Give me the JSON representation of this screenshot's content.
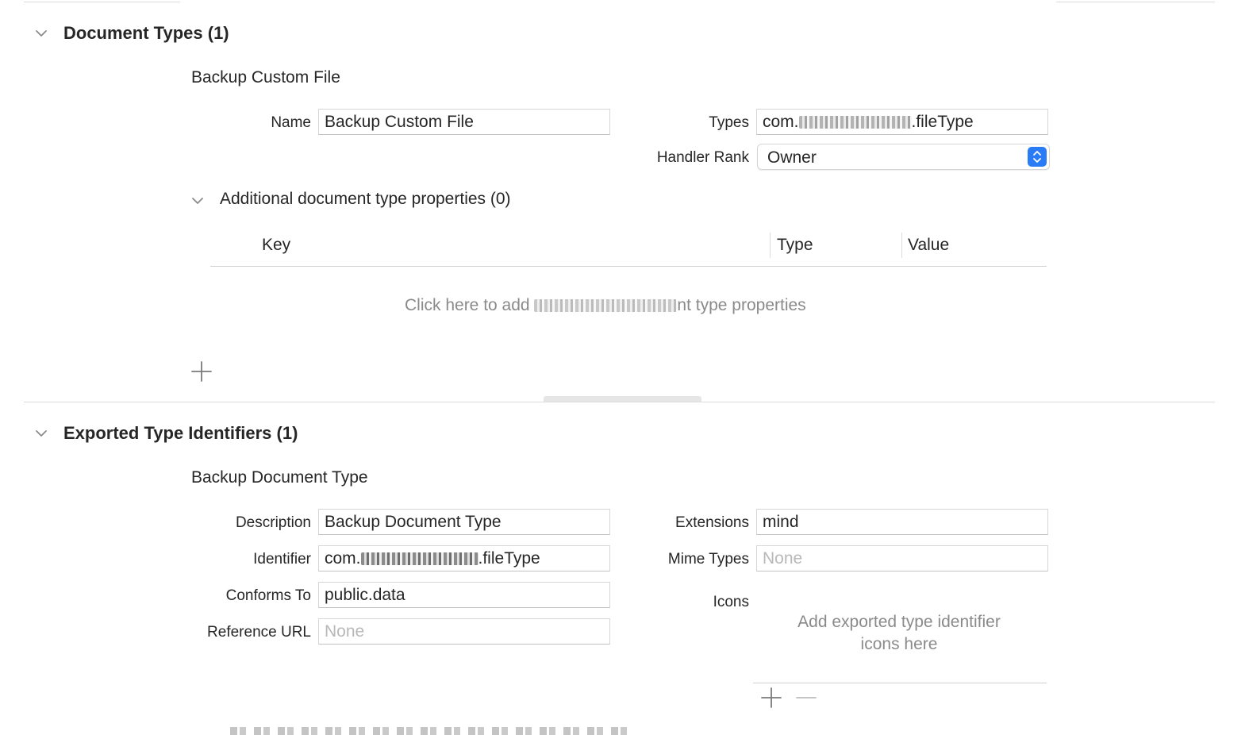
{
  "document_types": {
    "title": "Document Types (1)",
    "entry_title": "Backup Custom File",
    "name_label": "Name",
    "name_value": "Backup Custom File",
    "types_label": "Types",
    "types_prefix": "com.",
    "types_suffix": ".fileType",
    "handler_rank_label": "Handler Rank",
    "handler_rank_value": "Owner",
    "additional": {
      "title": "Additional document type properties (0)",
      "columns": [
        "Key",
        "Type",
        "Value"
      ],
      "hint_prefix": "Click here to add ",
      "hint_suffix": "nt type properties"
    }
  },
  "exported_types": {
    "title": "Exported Type Identifiers (1)",
    "entry_title": "Backup Document Type",
    "description_label": "Description",
    "description_value": "Backup Document Type",
    "identifier_label": "Identifier",
    "identifier_prefix": "com.",
    "identifier_suffix": ".fileType",
    "conforms_label": "Conforms To",
    "conforms_value": "public.data",
    "reference_url_label": "Reference URL",
    "reference_url_placeholder": "None",
    "extensions_label": "Extensions",
    "extensions_value": "mind",
    "mime_types_label": "Mime Types",
    "mime_types_placeholder": "None",
    "icons_label": "Icons",
    "icons_hint_line1": "Add exported type identifier",
    "icons_hint_line2": "icons here"
  },
  "icons": {
    "disclosure": "chevron-down-icon",
    "add": "plus-icon",
    "remove": "minus-icon",
    "popup": "up-down-chevron-icon"
  },
  "colors": {
    "accent": "#2a7cf6",
    "separator": "#dcdcdc",
    "placeholder": "#b8b8b8",
    "hint": "#8a8a8a"
  }
}
